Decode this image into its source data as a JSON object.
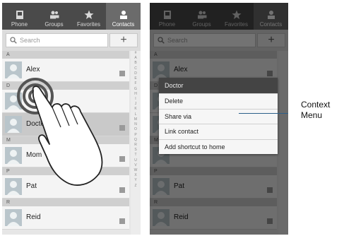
{
  "tabs": [
    {
      "label": "Phone",
      "icon": "phone-icon"
    },
    {
      "label": "Groups",
      "icon": "groups-icon"
    },
    {
      "label": "Favorites",
      "icon": "star-icon"
    },
    {
      "label": "Contacts",
      "icon": "contact-icon"
    }
  ],
  "active_tab": "Contacts",
  "search": {
    "placeholder": "Search"
  },
  "add_label": "+",
  "sections": [
    "A",
    "D",
    "M",
    "P",
    "R"
  ],
  "contacts": [
    "Alex",
    "Doctor",
    "Mom",
    "Pat",
    "Reid"
  ],
  "index_letters": [
    "#",
    "A",
    "B",
    "C",
    "D",
    "E",
    "F",
    "G",
    "H",
    "I",
    "J",
    "K",
    "L",
    "M",
    "N",
    "O",
    "P",
    "Q",
    "R",
    "S",
    "T",
    "U",
    "V",
    "W",
    "X",
    "Y",
    "Z"
  ],
  "context_menu": {
    "title": "Doctor",
    "items": [
      "Delete",
      "Share via",
      "Link contact",
      "Add shortcut to home"
    ]
  },
  "callout": {
    "line1": "Context",
    "line2": "Menu"
  },
  "colors": {
    "tab_bar": "#4a4a4a",
    "active_tab": "#6b6b6b",
    "menu_title_bg": "#444444",
    "callout_line": "#2c5f8a"
  }
}
